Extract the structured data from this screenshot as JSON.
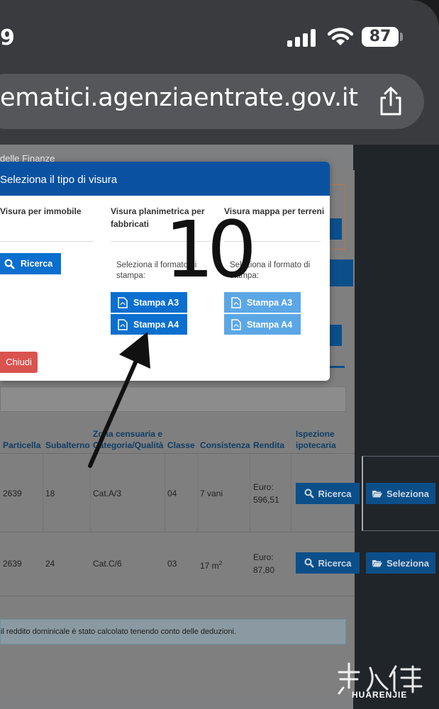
{
  "status": {
    "clock": "9",
    "battery": "87"
  },
  "browser": {
    "url": "ematici.agenziaentrate.gov.it"
  },
  "site": {
    "header_text": "delle Finanze"
  },
  "modal": {
    "title": "Seleziona il tipo di visura",
    "col1": {
      "title": "Visura per immobile",
      "button": "Ricerca"
    },
    "col2": {
      "title_line1": "Visura planimetrica per",
      "title_line2": "fabbricati",
      "hint_line1": "Seleziona il formato di",
      "hint_line2": "stampa:",
      "btn_a3": "Stampa A3",
      "btn_a4": "Stampa A4"
    },
    "col3": {
      "title": "Visura mappa per terreni",
      "hint_line1": "Seleziona il formato di",
      "hint_line2": "stampa:",
      "btn_a3": "Stampa A3",
      "btn_a4": "Stampa A4"
    },
    "close": "Chiudi"
  },
  "table": {
    "headers": {
      "particella": "Particella",
      "subalterno": "Subalterno",
      "zona_line1": "Zona censuaria e",
      "zona_line2": "Categoria/Qualità",
      "classe": "Classe",
      "consistenza": "Consistenza",
      "rendita": "Rendita",
      "ispezione_line1": "Ispezione",
      "ispezione_line2": "ipotecaria"
    },
    "rows": [
      {
        "particella": "2639",
        "subalterno": "18",
        "categoria": "Cat.A/3",
        "classe": "04",
        "consistenza": "7 vani",
        "rendita_line1": "Euro:",
        "rendita_line2": "596,51",
        "btn_ricerca": "Ricerca",
        "btn_seleziona": "Seleziona"
      },
      {
        "particella": "2639",
        "subalterno": "24",
        "categoria": "Cat.C/6",
        "classe": "03",
        "consistenza": "17 m",
        "consistenza_sup": "2",
        "rendita_line1": "Euro:",
        "rendita_line2": "87,80",
        "btn_ricerca": "Ricerca",
        "btn_seleziona": "Seleziona"
      }
    ],
    "footnote": "il reddito dominicale è stato calcolato tenendo conto delle deduzioni."
  },
  "annotation": {
    "number": "10"
  },
  "watermark": {
    "text": "HUARENJIE"
  }
}
